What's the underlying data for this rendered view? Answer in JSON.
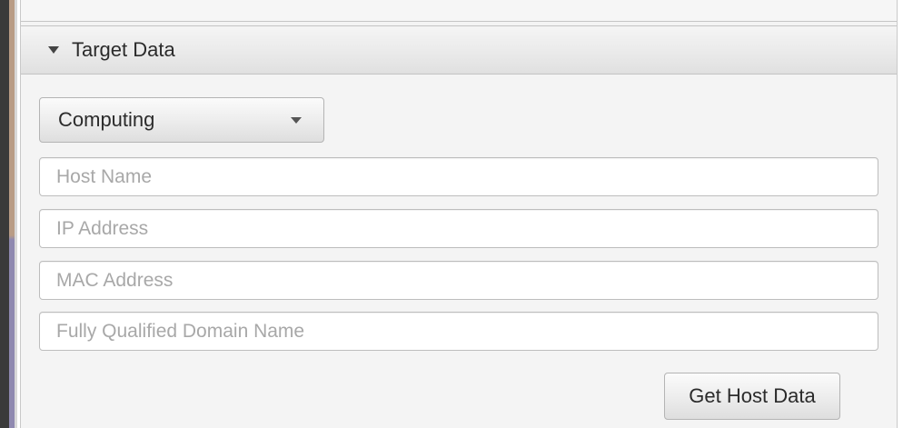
{
  "panel": {
    "title": "Target Data",
    "expanded": true
  },
  "type_selector": {
    "selected": "Computing"
  },
  "fields": {
    "host_name": {
      "value": "",
      "placeholder": "Host Name"
    },
    "ip_address": {
      "value": "",
      "placeholder": "IP Address"
    },
    "mac_address": {
      "value": "",
      "placeholder": "MAC Address"
    },
    "fqdn": {
      "value": "",
      "placeholder": "Fully Qualified Domain Name"
    }
  },
  "actions": {
    "get_host_data_label": "Get Host Data"
  },
  "icons": {
    "panel_toggle": "triangle-down-icon",
    "combo_dropdown": "chevron-down-icon"
  },
  "colors": {
    "frame_accent_top": "#b99c85",
    "frame_accent_bottom": "#8f89b0",
    "panel_background": "#f4f4f4",
    "placeholder_text": "#a8a8a8"
  }
}
